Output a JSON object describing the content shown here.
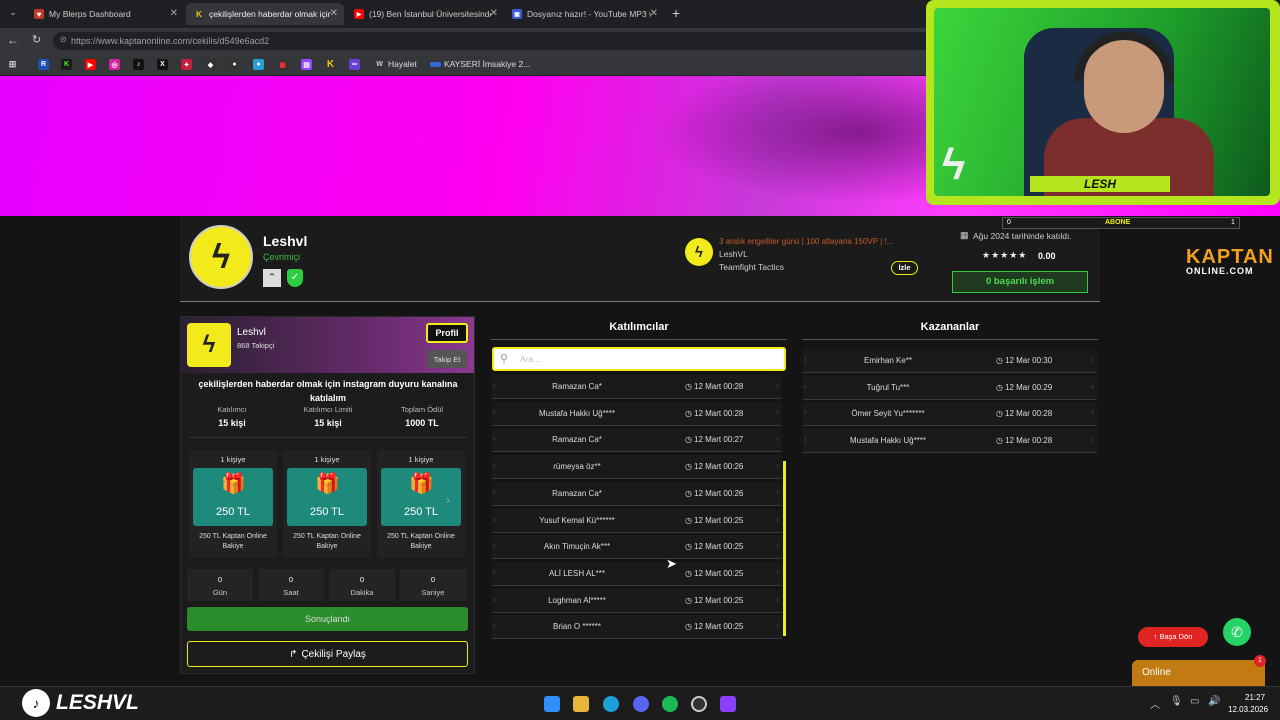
{
  "browser": {
    "tabs": [
      {
        "title": "My Blerps Dashboard",
        "icon": "blerps-icon",
        "color": "#c0392b"
      },
      {
        "title": "çekilişlerden haberdar olmak için i...",
        "icon": "kaptan-icon",
        "color": "#f0c419"
      },
      {
        "title": "(19) Ben İstanbul Üniversitesinde H...",
        "icon": "youtube-icon",
        "color": "#ff0000"
      },
      {
        "title": "Dosyanız hazır! - YouTube MP3 ve...",
        "icon": "converter-icon",
        "color": "#3b5bdb"
      }
    ],
    "new_tab": "+",
    "url": "https://www.kaptanonline.com/cekilis/d549e6acd2",
    "bookmarks": [
      "Hayalet",
      "KAYSERİ İmsakiye 2..."
    ]
  },
  "profile": {
    "name": "Leshvl",
    "status": "Çevrimiçi",
    "stream_title": "3 aralık engelliler günü | 100 atlayana 150VP | !...",
    "streamer": "LeshVL",
    "game": "Teamfight Tactics",
    "watch_label": "İzle",
    "member_since": "Ağu 2024 tarihinde katıldı.",
    "rating": "0.00",
    "success_label": "0 başarılı işlem"
  },
  "card": {
    "name": "Leshvl",
    "followers": "868 Takipçi",
    "profile_btn": "Profil",
    "follow_btn": "Takip Et",
    "description": "çekilişlerden haberdar olmak için instagram duyuru kanalına katılalım",
    "stats": [
      {
        "label": "Katılımcı",
        "value": "15 kişi"
      },
      {
        "label": "Katılımcı Limiti",
        "value": "15 kişi"
      },
      {
        "label": "Toplam Ödül",
        "value": "1000 TL"
      }
    ],
    "prizes": [
      {
        "people": "1 kişiye",
        "amount": "250 TL",
        "desc": "250 TL Kaptan Online Bakiye"
      },
      {
        "people": "1 kişiye",
        "amount": "250 TL",
        "desc": "250 TL Kaptan Online Bakiye"
      },
      {
        "people": "1 kişiye",
        "amount": "250 TL",
        "desc": "250 TL Kaptan Online Bakiye"
      }
    ],
    "countdown": [
      {
        "n": "0",
        "u": "Gün"
      },
      {
        "n": "0",
        "u": "Saat"
      },
      {
        "n": "0",
        "u": "Dakika"
      },
      {
        "n": "0",
        "u": "Saniye"
      }
    ],
    "ended_btn": "Sonuçlandı",
    "share_btn": "Çekilişi Paylaş"
  },
  "participants": {
    "title": "Katılımcılar",
    "search_placeholder": "Ara...",
    "rows": [
      {
        "name": "Ramazan Ca*",
        "time": "12 Mart 00:28"
      },
      {
        "name": "Mustafa Hakkı Uğ****",
        "time": "12 Mart 00:28"
      },
      {
        "name": "Ramazan Ca*",
        "time": "12 Mart 00:27"
      },
      {
        "name": "rümeysa öz**",
        "time": "12 Mart 00:26"
      },
      {
        "name": "Ramazan Ca*",
        "time": "12 Mart 00:26"
      },
      {
        "name": "Yusuf Kemal Kü******",
        "time": "12 Mart 00:25"
      },
      {
        "name": "Akın Timuçin Ak***",
        "time": "12 Mart 00:25"
      },
      {
        "name": "ALİ LESH AL***",
        "time": "12 Mart 00:25"
      },
      {
        "name": "Loghman Al*****",
        "time": "12 Mart 00:25"
      },
      {
        "name": "Brian O ******",
        "time": "12 Mart 00:25"
      }
    ]
  },
  "winners": {
    "title": "Kazananlar",
    "rows": [
      {
        "name": "Emirhan Ke**",
        "time": "12 Mar 00:30"
      },
      {
        "name": "Tuğrul Tu***",
        "time": "12 Mar 00:29"
      },
      {
        "name": "Ömer Seyit Yu*******",
        "time": "12 Mar 00:28"
      },
      {
        "name": "Mustafa Hakkı Uğ****",
        "time": "12 Mar 00:28"
      }
    ]
  },
  "overlay": {
    "cam_name": "LESH",
    "sub_left": "0",
    "sub_label": "ABONE",
    "sub_right": "1",
    "brand_top": "KAPTAN",
    "brand_bottom": "ONLINE.COM",
    "tiktok_name": "LESHVL",
    "back_top": "Başa Dön",
    "online": "Online",
    "online_badge": "1"
  },
  "taskbar": {
    "time": "21:27",
    "date": "12.03.2026"
  }
}
